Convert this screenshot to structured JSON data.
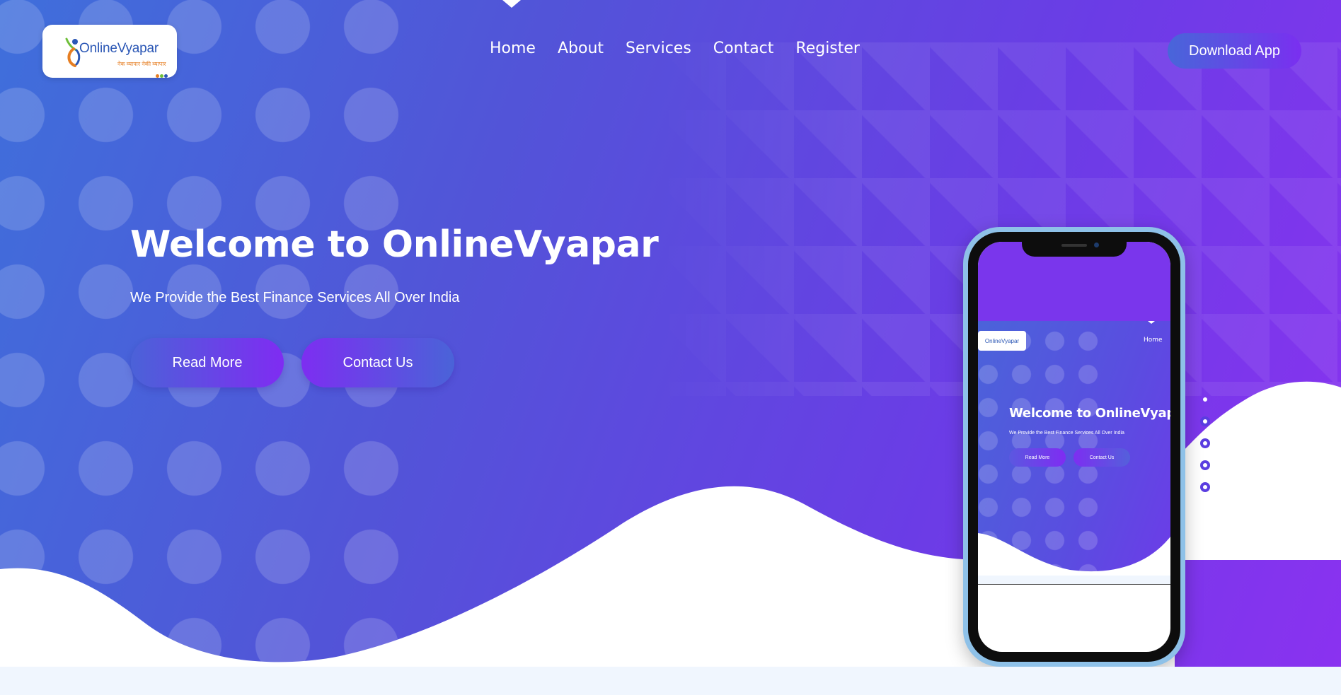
{
  "brand": {
    "logo_name": "OnlineVyapar",
    "logo_tagline": "नेक व्यापार नेकी व्यापार"
  },
  "nav": {
    "items": [
      {
        "label": "Home"
      },
      {
        "label": "About"
      },
      {
        "label": "Services"
      },
      {
        "label": "Contact"
      },
      {
        "label": "Register"
      }
    ],
    "download_label": "Download App"
  },
  "hero": {
    "title": "Welcome to OnlineVyapar",
    "subtitle": "We Provide the Best Finance Services All Over India",
    "read_more_label": "Read More",
    "contact_label": "Contact Us"
  },
  "phone_preview": {
    "logo_name": "OnlineVyapar",
    "nav_label": "Home",
    "title": "Welcome to OnlineVyapar",
    "subtitle": "We Provide the Best Finance Services All Over India",
    "read_more_label": "Read More",
    "contact_label": "Contact Us"
  },
  "slider": {
    "count": 5,
    "active_index": 0
  },
  "colors": {
    "gradient_start": "#3f6fdb",
    "gradient_mid": "#5254d8",
    "gradient_end": "#8a32f0",
    "accent_purple": "#7a36ec",
    "page_bg": "#f0f6fe",
    "phone_frame": "#8ec1e8"
  }
}
